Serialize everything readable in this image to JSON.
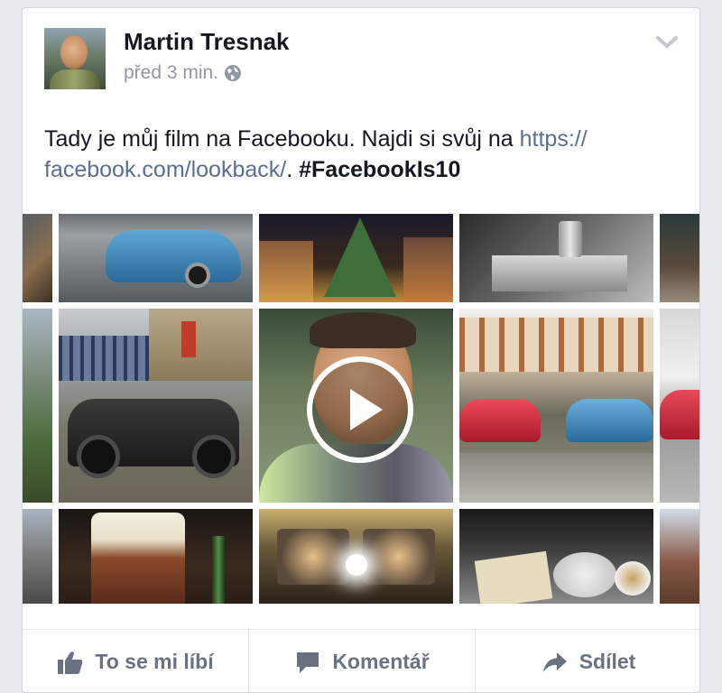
{
  "post": {
    "author": "Martin Tresnak",
    "time": "před 3 min.",
    "text_before": "Tady je můj film na Facebooku. Najdi si svůj na ",
    "link": "https://\nfacebook.com/lookback/",
    "text_after": ". ",
    "hashtag": "#FacebookIs10"
  },
  "actions": {
    "like": "To se mi líbí",
    "comment": "Komentář",
    "share": "Sdílet"
  },
  "icons": {
    "privacy": "globe-icon",
    "menu": "chevron-down-icon",
    "like": "thumbs-up-icon",
    "comment": "speech-bubble-icon",
    "share": "share-arrow-icon",
    "video": "play-icon"
  },
  "colors": {
    "text": "#141823",
    "link": "#5b6f94",
    "meta": "#9197a3",
    "action": "#6a7180"
  }
}
